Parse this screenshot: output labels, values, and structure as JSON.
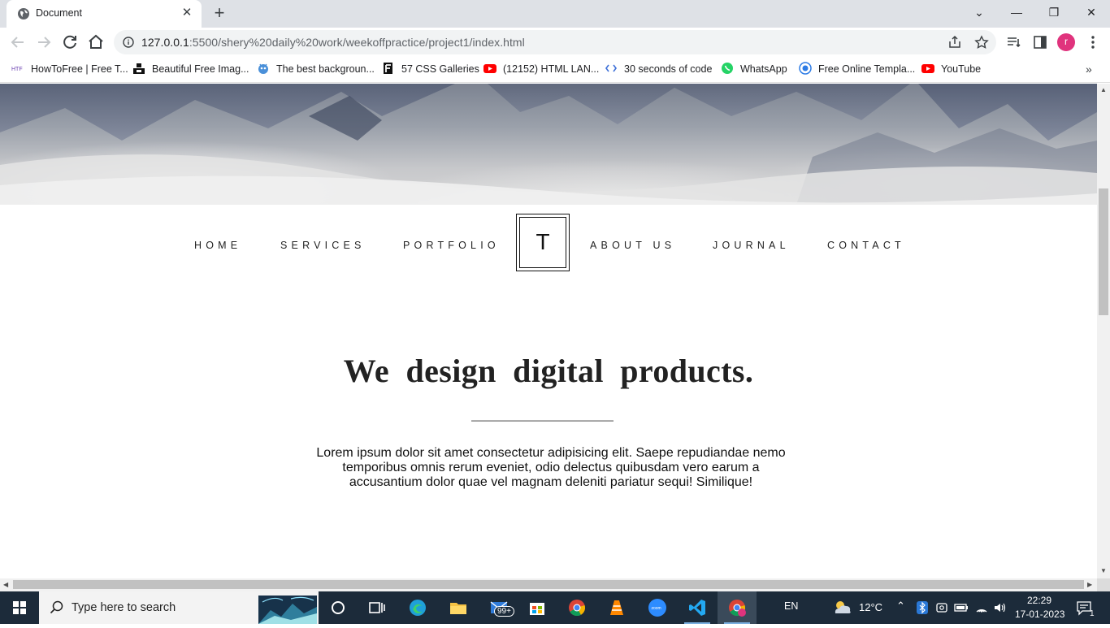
{
  "browser": {
    "tab_title": "Document",
    "url_host": "127.0.0.1",
    "url_path": ":5500/shery%20daily%20work/weekoffpractice/project1/index.html",
    "profile_initial": "r",
    "bookmarks": [
      {
        "label": "HowToFree | Free T...",
        "icon": "howtofree-icon"
      },
      {
        "label": "Beautiful Free Imag...",
        "icon": "unsplash-icon"
      },
      {
        "label": "The best backgroun...",
        "icon": "bg-icon"
      },
      {
        "label": "57 CSS Galleries",
        "icon": "f-icon"
      },
      {
        "label": "(12152) HTML LAN...",
        "icon": "youtube-icon"
      },
      {
        "label": "30 seconds of code",
        "icon": "code-icon"
      },
      {
        "label": "WhatsApp",
        "icon": "whatsapp-icon"
      },
      {
        "label": "Free Online Templa...",
        "icon": "template-icon"
      },
      {
        "label": "YouTube",
        "icon": "youtube-icon"
      }
    ],
    "bookmarks_overflow": "»"
  },
  "page": {
    "nav": {
      "home": "HOME",
      "services": "SERVICES",
      "portfolio": "PORTFOLIO",
      "logo": "T",
      "about": "ABOUT US",
      "journal": "JOURNAL",
      "contact": "CONTACT"
    },
    "heading": "We design digital products.",
    "paragraph": "Lorem ipsum dolor sit amet consectetur adipisicing elit. Saepe repudiandae nemo temporibus omnis rerum eveniet, odio delectus quibusdam vero earum a accusantium dolor quae vel magnam deleniti pariatur sequi! Similique!"
  },
  "taskbar": {
    "search_placeholder": "Type here to search",
    "mail_badge": "99+",
    "language": "EN",
    "temperature": "12°C",
    "time": "22:29",
    "date": "17-01-2023",
    "notification_count": "1"
  },
  "colors": {
    "chrome_tabstrip": "#dee1e6",
    "omnibox": "#f1f3f4",
    "avatar": "#e0337d",
    "taskbar": "#1c2b3a"
  }
}
